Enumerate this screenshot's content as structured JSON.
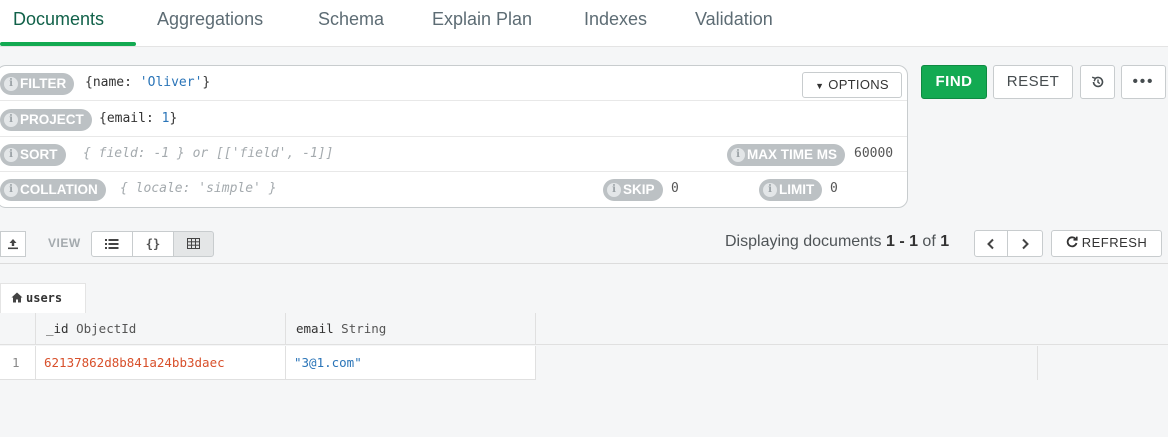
{
  "tabs": [
    {
      "label": "Documents"
    },
    {
      "label": "Aggregations"
    },
    {
      "label": "Schema"
    },
    {
      "label": "Explain Plan"
    },
    {
      "label": "Indexes"
    },
    {
      "label": "Validation"
    }
  ],
  "query": {
    "filter_label": "FILTER",
    "filter_value_prefix": "{name: ",
    "filter_value_string": "'Oliver'",
    "filter_value_suffix": "}",
    "project_label": "PROJECT",
    "project_value_prefix": "{email: ",
    "project_value_number": "1",
    "project_value_suffix": "}",
    "sort_label": "SORT",
    "sort_placeholder": "{ field: -1 } or [['field', -1]]",
    "collation_label": "COLLATION",
    "collation_placeholder": "{ locale: 'simple' }",
    "max_time_label": "MAX TIME MS",
    "max_time_value": "60000",
    "skip_label": "SKIP",
    "skip_value": "0",
    "limit_label": "LIMIT",
    "limit_value": "0",
    "options_label": "OPTIONS"
  },
  "actions": {
    "find_label": "FIND",
    "reset_label": "RESET",
    "history_icon": "history-icon",
    "more_icon": "ellipsis-icon"
  },
  "toolbar": {
    "view_label": "VIEW",
    "display_prefix": "Displaying documents ",
    "display_range": "1 - 1",
    "display_of": " of ",
    "display_total": "1",
    "refresh_label": "REFRESH"
  },
  "table": {
    "collection_name": "users",
    "columns": [
      {
        "name": "_id",
        "type": "ObjectId"
      },
      {
        "name": "email",
        "type": "String"
      }
    ],
    "rows": [
      {
        "num": "1",
        "id": "62137862d8b841a24bb3daec",
        "email": "\"3@1.com\""
      }
    ]
  },
  "colors": {
    "accent": "#13aa52",
    "active_tab_text": "#116149",
    "objectid": "#d8502b",
    "string": "#2b75b8"
  }
}
